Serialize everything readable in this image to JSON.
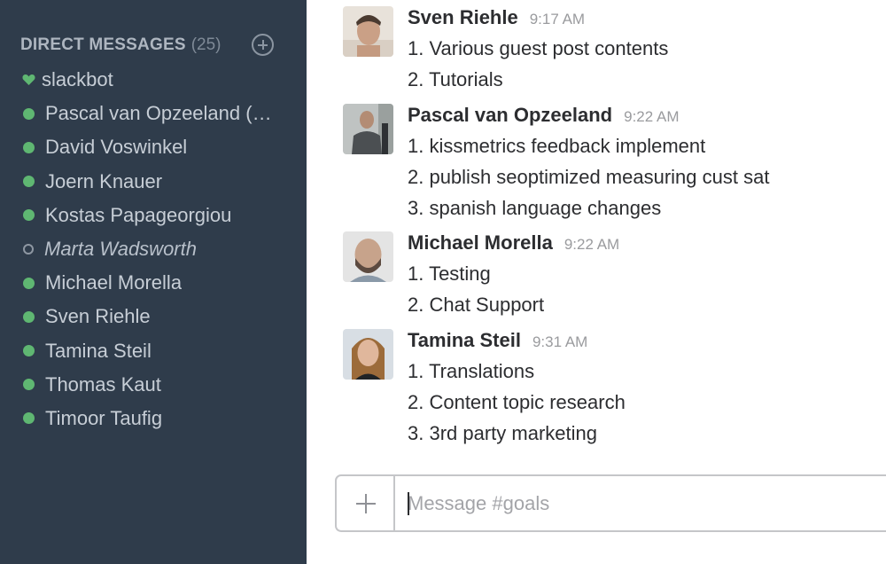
{
  "sidebar": {
    "title": "DIRECT MESSAGES",
    "count": "(25)",
    "items": [
      {
        "label": "slackbot",
        "status": "heart"
      },
      {
        "label": "Pascal van Opzeeland (…",
        "status": "online"
      },
      {
        "label": "David Voswinkel",
        "status": "online"
      },
      {
        "label": "Joern Knauer",
        "status": "online"
      },
      {
        "label": "Kostas Papageorgiou",
        "status": "online"
      },
      {
        "label": "Marta Wadsworth",
        "status": "away"
      },
      {
        "label": "Michael Morella",
        "status": "online"
      },
      {
        "label": "Sven Riehle",
        "status": "online"
      },
      {
        "label": "Tamina Steil",
        "status": "online"
      },
      {
        "label": "Thomas Kaut",
        "status": "online"
      },
      {
        "label": "Timoor Taufig",
        "status": "online"
      }
    ]
  },
  "messages": [
    {
      "author": "Sven Riehle",
      "time": "9:17 AM",
      "lines": [
        "1. Various guest post contents",
        "2. Tutorials"
      ]
    },
    {
      "author": "Pascal van Opzeeland",
      "time": "9:22 AM",
      "lines": [
        "1. kissmetrics feedback implement",
        "2. publish seoptimized measuring cust sat",
        "3. spanish language changes"
      ]
    },
    {
      "author": "Michael Morella",
      "time": "9:22 AM",
      "lines": [
        "1. Testing",
        "2. Chat Support"
      ]
    },
    {
      "author": "Tamina Steil",
      "time": "9:31 AM",
      "lines": [
        "1. Translations",
        "2. Content topic research",
        "3. 3rd party marketing"
      ]
    }
  ],
  "composer": {
    "placeholder": "Message #goals"
  },
  "colors": {
    "sidebar_bg": "#2f3c4b",
    "presence_online": "#5fb772"
  }
}
